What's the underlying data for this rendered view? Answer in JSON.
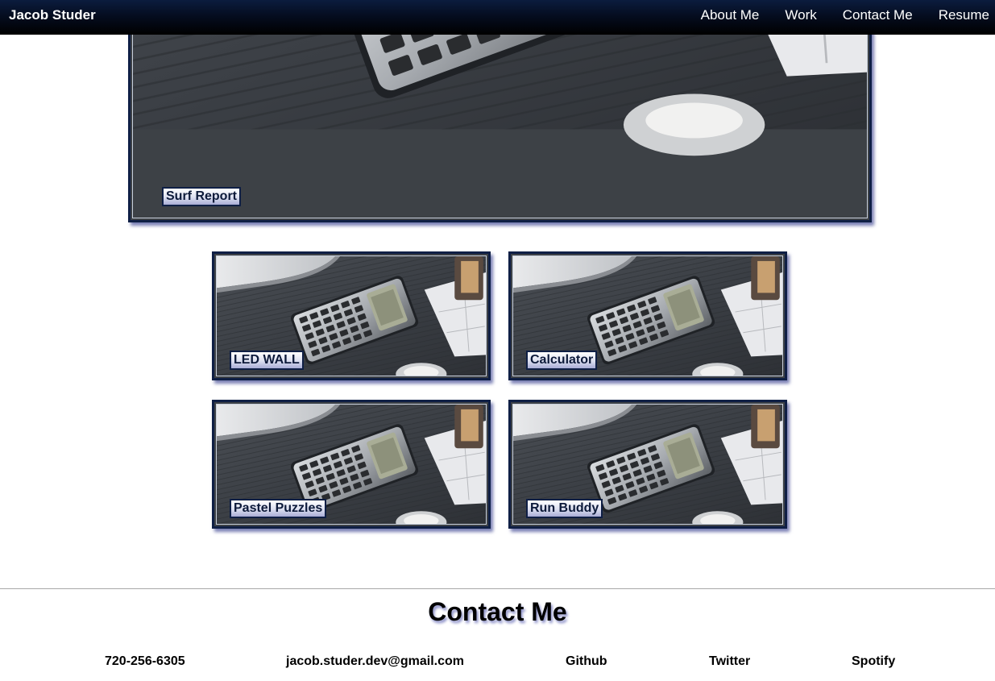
{
  "nav": {
    "brand": "Jacob Studer",
    "links": [
      "About Me",
      "Work",
      "Contact Me",
      "Resume"
    ]
  },
  "projects": {
    "featured": {
      "label": "Surf Report",
      "image": "calculator-desk-photo"
    },
    "grid": [
      {
        "label": "LED WALL",
        "image": "calculator-desk-photo"
      },
      {
        "label": "Calculator",
        "image": "calculator-desk-photo"
      },
      {
        "label": "Pastel Puzzles",
        "image": "calculator-desk-photo"
      },
      {
        "label": "Run Buddy",
        "image": "calculator-desk-photo"
      }
    ]
  },
  "contact": {
    "title": "Contact Me",
    "phone": "720-256-6305",
    "email": "jacob.studer.dev@gmail.com",
    "github": "Github",
    "twitter": "Twitter",
    "spotify": "Spotify"
  },
  "colors": {
    "navbar": "#050d20",
    "tile_border": "#0f1f45",
    "tile_shadow": "#7a7fb4",
    "label_text": "#0d1a3a"
  }
}
